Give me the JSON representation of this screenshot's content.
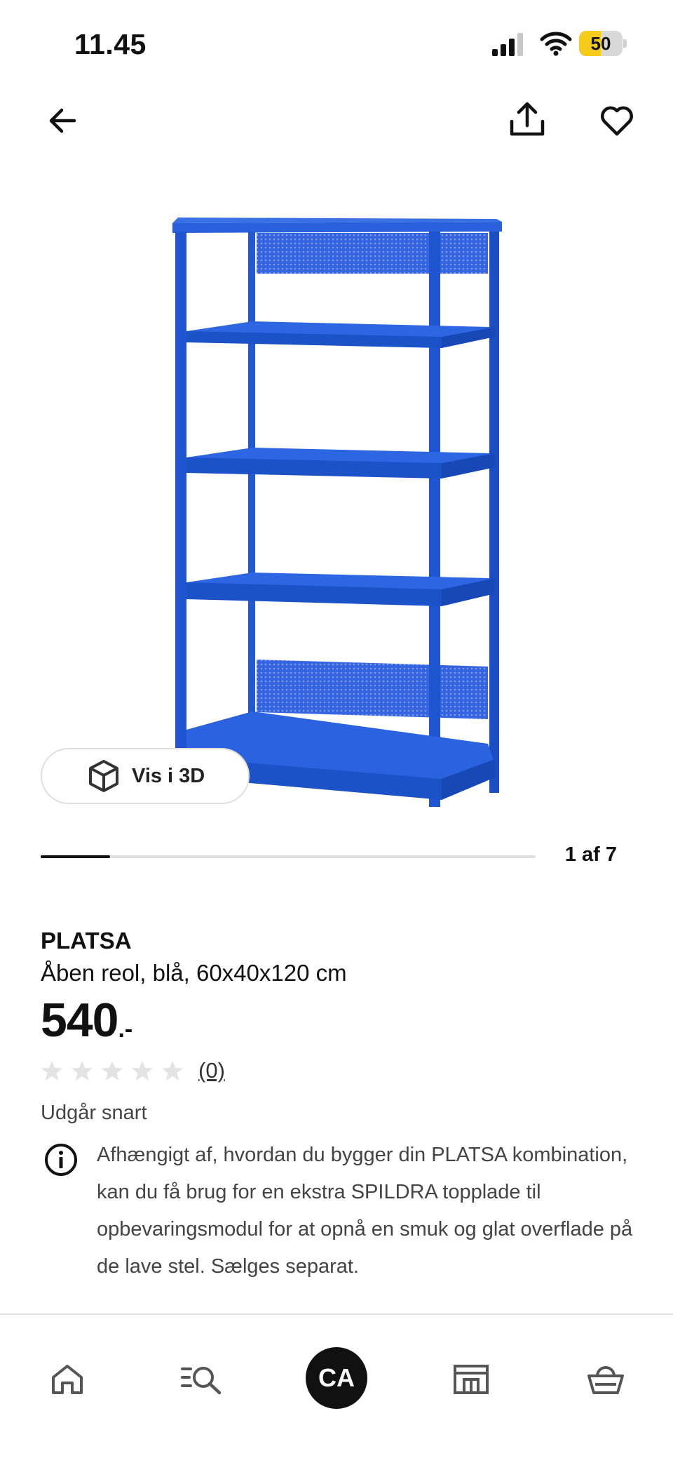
{
  "status_bar": {
    "time": "11.45",
    "battery_level": "50",
    "battery_color": "#f5cc19",
    "icons": [
      "cellular-signal-icon",
      "wifi-icon",
      "battery-icon"
    ]
  },
  "top_nav": {
    "icons": [
      "arrow-left-icon",
      "share-icon",
      "heart-icon"
    ]
  },
  "product_image": {
    "color": "#1f58d6"
  },
  "view_3d": {
    "label": "Vis i 3D",
    "icon": "cube-icon"
  },
  "carousel": {
    "counter": "1 af 7",
    "progress_fraction": 0.14
  },
  "product": {
    "name": "PLATSA",
    "description": "Åben reol, blå, 60x40x120 cm",
    "price_integer": "540",
    "price_suffix": ".-",
    "rating_stars_filled": 0,
    "rating_stars_total": 5,
    "rating_count": "(0)",
    "availability": "Udgår snart",
    "info_icon": "info-icon",
    "info_text": "Afhængigt af, hvordan du bygger din PLATSA kombination, kan du få brug for en ekstra SPILDRA topplade til opbevaringsmodul for at opnå en smuk og glat overflade på de lave stel. Sælges separat."
  },
  "bottom_nav": {
    "account_initials": "CA",
    "icons": [
      "home-icon",
      "search-list-icon",
      "store-icon",
      "basket-icon"
    ]
  }
}
